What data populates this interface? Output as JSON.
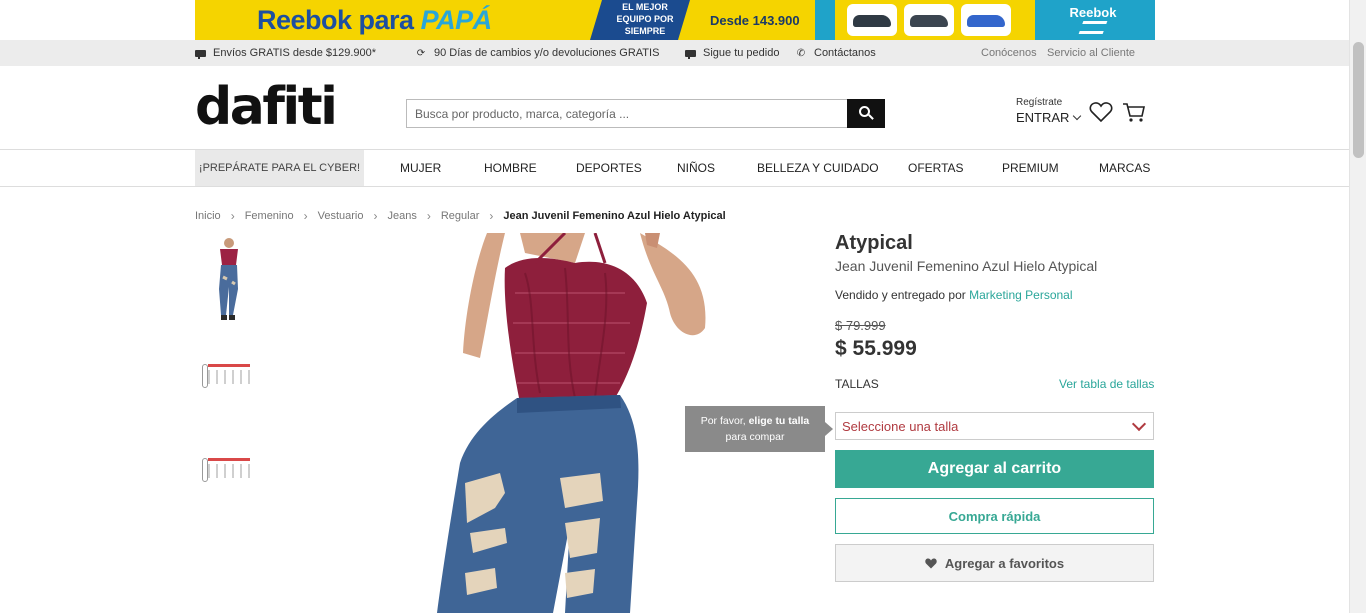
{
  "banner": {
    "title_main": "Reebok para",
    "title_accent": "PAPÁ",
    "badge_text": "EL MEJOR EQUIPO POR SIEMPRE",
    "price_text": "Desde 143.900",
    "brand": "Reebok"
  },
  "infobar": {
    "shipping": "Envíos GRATIS desde $129.900*",
    "returns": "90 Días de cambios y/o devoluciones GRATIS",
    "track": "Sigue tu pedido",
    "contact": "Contáctanos",
    "about": "Conócenos",
    "service": "Servicio al Cliente"
  },
  "header": {
    "logo": "dafiti",
    "search_placeholder": "Busca por producto, marca, categoría ...",
    "register": "Regístrate",
    "login": "ENTRAR"
  },
  "nav": {
    "promo": "¡PREPÁRATE PARA EL CYBER!",
    "items": [
      "MUJER",
      "HOMBRE",
      "DEPORTES",
      "NIÑOS",
      "BELLEZA Y CUIDADO",
      "OFERTAS",
      "PREMIUM",
      "MARCAS"
    ]
  },
  "breadcrumb": {
    "items": [
      "Inicio",
      "Femenino",
      "Vestuario",
      "Jeans",
      "Regular"
    ],
    "current": "Jean Juvenil Femenino Azul Hielo Atypical"
  },
  "product": {
    "brand": "Atypical",
    "name": "Jean Juvenil Femenino Azul Hielo Atypical",
    "seller_prefix": "Vendido y entregado por",
    "seller_name": "Marketing Personal",
    "old_price": "$ 79.999",
    "price": "$ 55.999",
    "sizes_label": "TALLAS",
    "size_chart_link": "Ver tabla de tallas",
    "tooltip_prefix": "Por favor,",
    "tooltip_bold": "elige tu talla",
    "tooltip_suffix": "para compar",
    "size_select": "Seleccione una talla",
    "add_to_cart": "Agregar al carrito",
    "quick_buy": "Compra rápida",
    "add_favorites": "Agregar a favoritos"
  },
  "colors": {
    "accent": "#37a894",
    "select_red": "#b03a40",
    "banner_blue": "#1fa3c9",
    "banner_yellow": "#f5d400"
  }
}
